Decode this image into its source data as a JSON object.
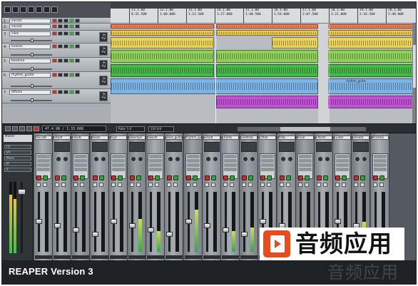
{
  "app": {
    "version_caption": "REAPER Version 3"
  },
  "ruler": {
    "marks": [
      {
        "bar": "11.1.00",
        "time": "0:31.500"
      },
      {
        "bar": "12.1.00",
        "time": "1:00.000"
      },
      {
        "bar": "13.1.00",
        "time": "1:13.500"
      },
      {
        "bar": "14.1.00",
        "time": "1:27.000"
      },
      {
        "bar": "15.1.00",
        "time": "1:40.500"
      },
      {
        "bar": "16.1.00",
        "time": "1:54.000"
      },
      {
        "bar": "17.1.00",
        "time": "2:07.500"
      },
      {
        "bar": "18.1.00",
        "time": "2:21.000"
      },
      {
        "bar": "19.1.00",
        "time": "2:34.500"
      },
      {
        "bar": "20.1.00",
        "time": "2:48.000"
      }
    ]
  },
  "tracks": [
    {
      "num": "1",
      "name": "vocal1",
      "color": "#ff7f4f"
    },
    {
      "num": "2",
      "name": "vocal2",
      "color": "#e9c74f"
    },
    {
      "num": "3",
      "name": "click",
      "color": "#e9d35a"
    },
    {
      "num": "4",
      "name": "kick/sn",
      "color": "#8fd05a"
    },
    {
      "num": "5",
      "name": "bassline",
      "color": "#47b847"
    },
    {
      "num": "6",
      "name": "rhythm_guitar",
      "color": "#7db4e6"
    },
    {
      "num": "7",
      "name": "effects",
      "color": "#c152d6"
    }
  ],
  "item_labels": {
    "rhythm": "rhythm_guitar"
  },
  "transport": {
    "time": "47.4.98 / 1:33.606",
    "rate": "Rate: 1.0",
    "bpm": "120 4/4"
  },
  "mixer": {
    "master_label": "Master",
    "master_buttons": [
      "FX",
      "I/O",
      "Mono",
      "M",
      "S"
    ],
    "strips": [
      {
        "name": "Vox Dbl",
        "level": 0.0
      },
      {
        "name": "Vox/R",
        "level": 0.0
      },
      {
        "name": "Vox/B",
        "level": 0.0
      },
      {
        "name": "Vox/D",
        "level": 0.0
      },
      {
        "name": "Keys",
        "level": 0.0
      },
      {
        "name": "Bass/Syn",
        "level": 0.55
      },
      {
        "name": "bass/R",
        "level": 0.35
      },
      {
        "name": "Bass_guitar",
        "level": 0.0
      },
      {
        "name": "Rhythm_guitar",
        "level": 0.7
      },
      {
        "name": "Elec/B",
        "level": 0.0
      },
      {
        "name": "Drums",
        "level": 0.35
      },
      {
        "name": "Snd/Rvb",
        "level": 0.4
      },
      {
        "name": "Other",
        "level": 0.0
      },
      {
        "name": "Amb",
        "level": 0.2
      },
      {
        "name": "Vocal",
        "level": 0.0
      },
      {
        "name": "Effects",
        "level": 0.0
      },
      {
        "name": "Guitar",
        "level": 0.3
      },
      {
        "name": "Reverb",
        "level": 0.5
      },
      {
        "name": "Reverb2",
        "level": 0.25
      }
    ]
  },
  "colors": {
    "window": "#3d4247",
    "arrange_bg": "#b9bdc1",
    "record": "#b7352f",
    "meter_green": "#3fc24a"
  },
  "watermark": {
    "text": "音频应用",
    "ghost_text": "音频应用",
    "logo_color": "#e74c1f"
  }
}
